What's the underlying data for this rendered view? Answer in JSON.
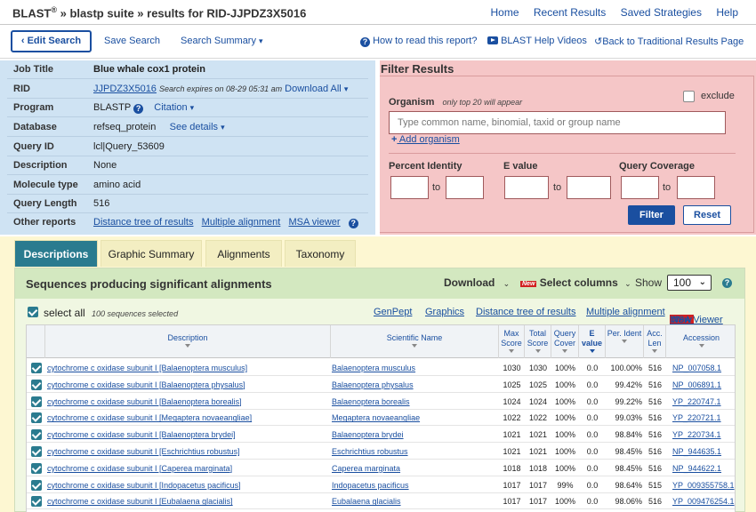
{
  "header": {
    "blast": "BLAST",
    "reg": "®",
    "crumb_rest": "» blastp suite » results for RID-JJPDZ3X5016",
    "nav": [
      "Home",
      "Recent Results",
      "Saved Strategies",
      "Help"
    ]
  },
  "toolbar": {
    "edit_search": "Edit Search",
    "save_search": "Save Search",
    "search_summary": "Search Summary",
    "how_to_read": "How to read this report?",
    "help_videos": "BLAST Help Videos",
    "back_traditional": "Back to Traditional Results Page"
  },
  "job": {
    "labels": [
      "Job Title",
      "RID",
      "Program",
      "Database",
      "Query ID",
      "Description",
      "Molecule type",
      "Query Length",
      "Other reports"
    ],
    "title": "Blue whale cox1 protein",
    "rid": "JJPDZ3X5016",
    "rid_expires": "Search expires on 08-29 05:31 am",
    "download_all": "Download All",
    "program": "BLASTP",
    "citation": "Citation",
    "database": "refseq_protein",
    "see_details": "See details",
    "query_id": "lcl|Query_53609",
    "description": "None",
    "molecule_type": "amino acid",
    "query_length": "516",
    "other_reports": [
      "Distance tree of results",
      "Multiple alignment",
      "MSA viewer"
    ]
  },
  "filter": {
    "title": "Filter Results",
    "organism_label": "Organism",
    "organism_note": "only top 20 will appear",
    "exclude": "exclude",
    "organism_placeholder": "Type common  name, binomial, taxid or group  name",
    "add_organism": "Add organism",
    "percent_identity": "Percent Identity",
    "e_value": "E value",
    "query_coverage": "Query Coverage",
    "to": "to",
    "filter_btn": "Filter",
    "reset_btn": "Reset"
  },
  "tabs": [
    "Descriptions",
    "Graphic Summary",
    "Alignments",
    "Taxonomy"
  ],
  "results": {
    "title": "Sequences producing significant alignments",
    "download": "Download",
    "new_badge": "New",
    "select_columns": "Select columns",
    "show_label": "Show",
    "show_value": "100",
    "select_all": "select all",
    "selected_note": "100 sequences selected",
    "links": [
      "GenPept",
      "Graphics",
      "Distance tree of results",
      "Multiple alignment",
      "MSA Viewer"
    ],
    "columns": [
      "Description",
      "Scientific Name",
      "Max Score",
      "Total Score",
      "Query Cover",
      "E value",
      "Per. Ident",
      "Acc. Len",
      "Accession"
    ],
    "rows": [
      {
        "desc": "cytochrome c oxidase subunit I [Balaenoptera musculus]",
        "sci": "Balaenoptera musculus",
        "max": "1030",
        "total": "1030",
        "cover": "100%",
        "e": "0.0",
        "ident": "100.00%",
        "len": "516",
        "acc": "NP_007058.1"
      },
      {
        "desc": "cytochrome c oxidase subunit I [Balaenoptera physalus]",
        "sci": "Balaenoptera physalus",
        "max": "1025",
        "total": "1025",
        "cover": "100%",
        "e": "0.0",
        "ident": "99.42%",
        "len": "516",
        "acc": "NP_006891.1"
      },
      {
        "desc": "cytochrome c oxidase subunit I [Balaenoptera borealis]",
        "sci": "Balaenoptera borealis",
        "max": "1024",
        "total": "1024",
        "cover": "100%",
        "e": "0.0",
        "ident": "99.22%",
        "len": "516",
        "acc": "YP_220747.1"
      },
      {
        "desc": "cytochrome c oxidase subunit I [Megaptera novaeangliae]",
        "sci": "Megaptera novaeangliae",
        "max": "1022",
        "total": "1022",
        "cover": "100%",
        "e": "0.0",
        "ident": "99.03%",
        "len": "516",
        "acc": "YP_220721.1"
      },
      {
        "desc": "cytochrome c oxidase subunit I [Balaenoptera brydei]",
        "sci": "Balaenoptera brydei",
        "max": "1021",
        "total": "1021",
        "cover": "100%",
        "e": "0.0",
        "ident": "98.84%",
        "len": "516",
        "acc": "YP_220734.1"
      },
      {
        "desc": "cytochrome c oxidase subunit I [Eschrichtius robustus]",
        "sci": "Eschrichtius robustus",
        "max": "1021",
        "total": "1021",
        "cover": "100%",
        "e": "0.0",
        "ident": "98.45%",
        "len": "516",
        "acc": "NP_944635.1"
      },
      {
        "desc": "cytochrome c oxidase subunit I [Caperea marginata]",
        "sci": "Caperea marginata",
        "max": "1018",
        "total": "1018",
        "cover": "100%",
        "e": "0.0",
        "ident": "98.45%",
        "len": "516",
        "acc": "NP_944622.1"
      },
      {
        "desc": "cytochrome c oxidase subunit I [Indopacetus pacificus]",
        "sci": "Indopacetus pacificus",
        "max": "1017",
        "total": "1017",
        "cover": "99%",
        "e": "0.0",
        "ident": "98.64%",
        "len": "515",
        "acc": "YP_009355758.1"
      },
      {
        "desc": "cytochrome c oxidase subunit I [Eubalaena glacialis]",
        "sci": "Eubalaena glacialis",
        "max": "1017",
        "total": "1017",
        "cover": "100%",
        "e": "0.0",
        "ident": "98.06%",
        "len": "516",
        "acc": "YP_009476254.1"
      }
    ]
  },
  "colors": {
    "job_bg": "#cfe3f3",
    "filter_bg": "#f5c6c7",
    "tab_active": "#2a7b8f",
    "results_bar": "#d3e8c0",
    "link": "#1a4fa0",
    "filter_btn": "#1a4fa0"
  }
}
